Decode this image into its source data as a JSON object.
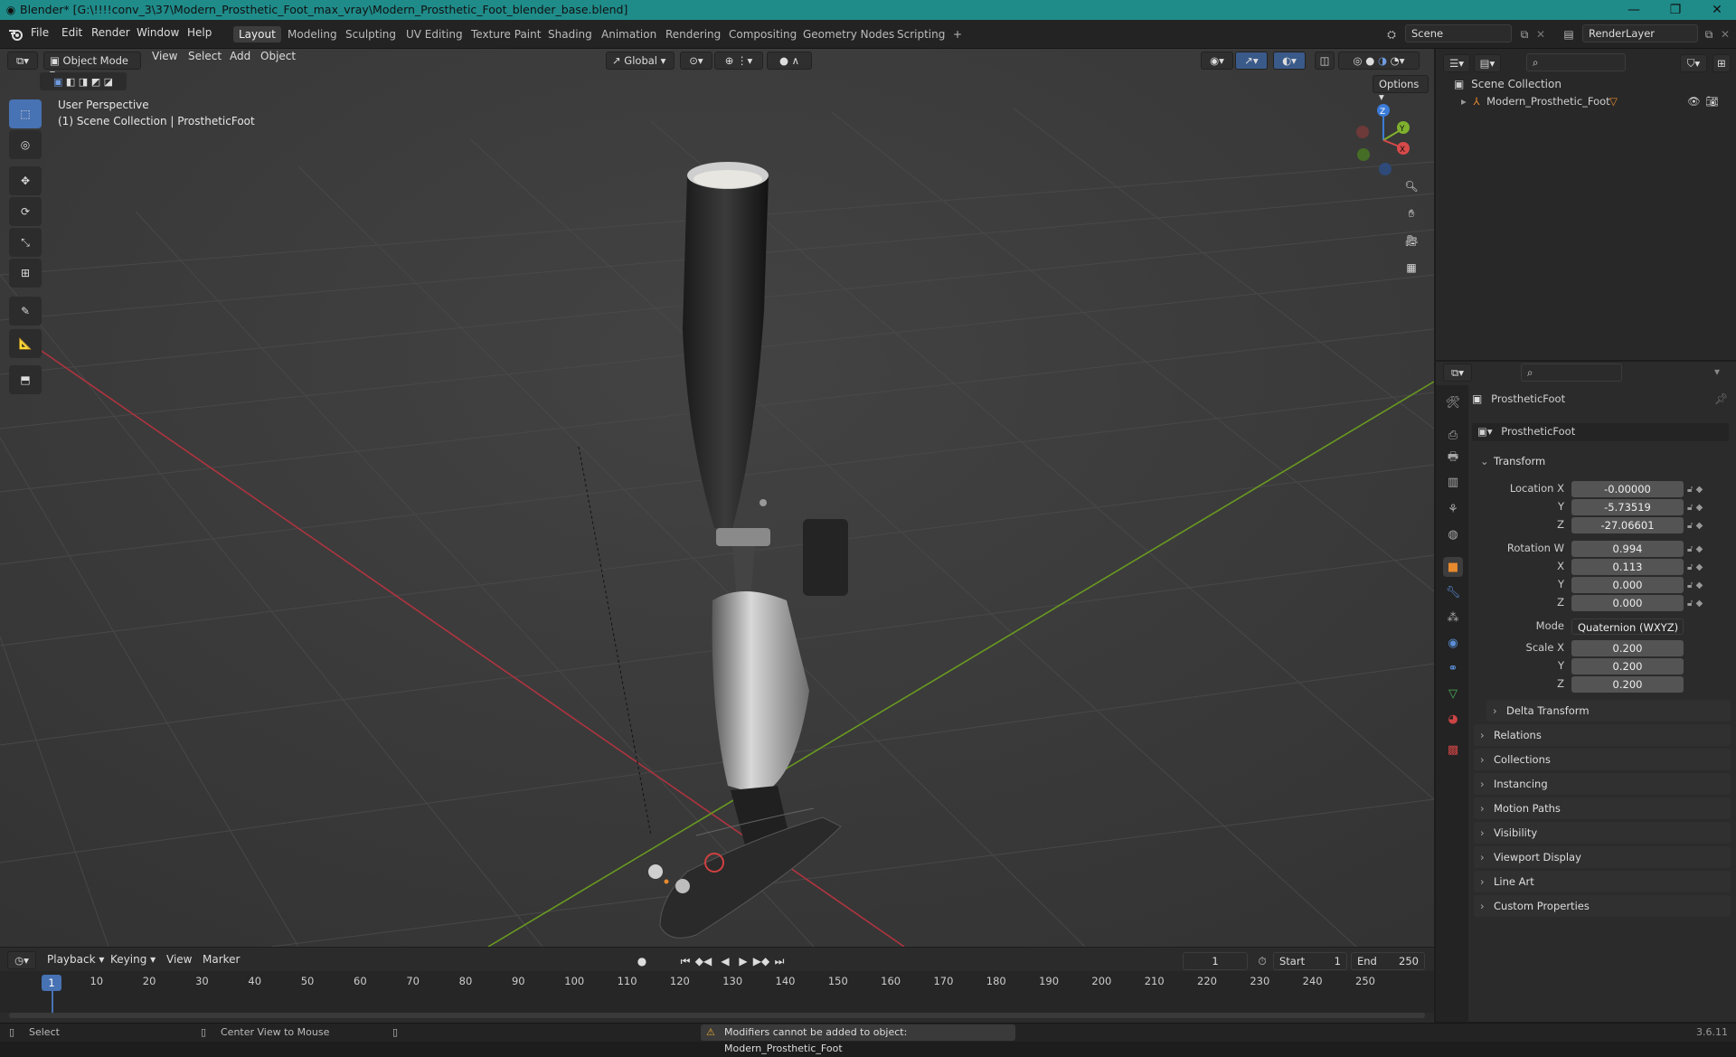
{
  "title": "Blender* [G:\\!!!!conv_3\\37\\Modern_Prosthetic_Foot_max_vray\\Modern_Prosthetic_Foot_blender_base.blend]",
  "menus": [
    "File",
    "Edit",
    "Render",
    "Window",
    "Help"
  ],
  "workspaces": [
    "Layout",
    "Modeling",
    "Sculpting",
    "UV Editing",
    "Texture Paint",
    "Shading",
    "Animation",
    "Rendering",
    "Compositing",
    "Geometry Nodes",
    "Scripting",
    "+"
  ],
  "scene": "Scene",
  "render_layer": "RenderLayer",
  "viewport": {
    "mode": "Object Mode",
    "menus": [
      "View",
      "Select",
      "Add",
      "Object"
    ],
    "transform_orientation": "Global",
    "options": "Options",
    "view_name": "User Perspective",
    "view_info": "(1) Scene Collection | ProstheticFoot",
    "gizmo": {
      "z": "Z",
      "y": "Y",
      "x": "X"
    }
  },
  "outliner": {
    "scene_collection": "Scene Collection",
    "item": "Modern_Prosthetic_Foot"
  },
  "properties": {
    "object_name": "ProstheticFoot",
    "data_name": "ProstheticFoot",
    "transform_label": "Transform",
    "location": {
      "label": "Location X",
      "x": "-0.00000",
      "y": "-5.73519",
      "z": "-27.06601"
    },
    "rotation": {
      "label": "Rotation W",
      "w": "0.994",
      "x": "0.113",
      "y": "0.000",
      "z": "0.000"
    },
    "mode_label": "Mode",
    "mode_value": "Quaternion (WXYZ)",
    "scale": {
      "label": "Scale X",
      "x": "0.200",
      "y": "0.200",
      "z": "0.200"
    },
    "axis_y": "Y",
    "axis_z": "Z",
    "axis_x": "X",
    "delta_transform": "Delta Transform",
    "panels": [
      "Relations",
      "Collections",
      "Instancing",
      "Motion Paths",
      "Visibility",
      "Viewport Display",
      "Line Art",
      "Custom Properties"
    ]
  },
  "timeline": {
    "menus": [
      "Playback",
      "Keying",
      "View",
      "Marker"
    ],
    "current_frame": "1",
    "start_label": "Start",
    "start": "1",
    "end_label": "End",
    "end": "250",
    "ticks": [
      "1",
      "10",
      "20",
      "30",
      "40",
      "50",
      "60",
      "70",
      "80",
      "90",
      "100",
      "110",
      "120",
      "130",
      "140",
      "150",
      "160",
      "170",
      "180",
      "190",
      "200",
      "210",
      "220",
      "230",
      "240",
      "250"
    ]
  },
  "status": {
    "select": "Select",
    "center": "Center View to Mouse",
    "warning": "Modifiers cannot be added to object: Modern_Prosthetic_Foot",
    "version": "3.6.11"
  },
  "colors": {
    "title_bar": "#1f8c8a",
    "accent": "#4772b3",
    "active_orange": "#e88a2e"
  }
}
